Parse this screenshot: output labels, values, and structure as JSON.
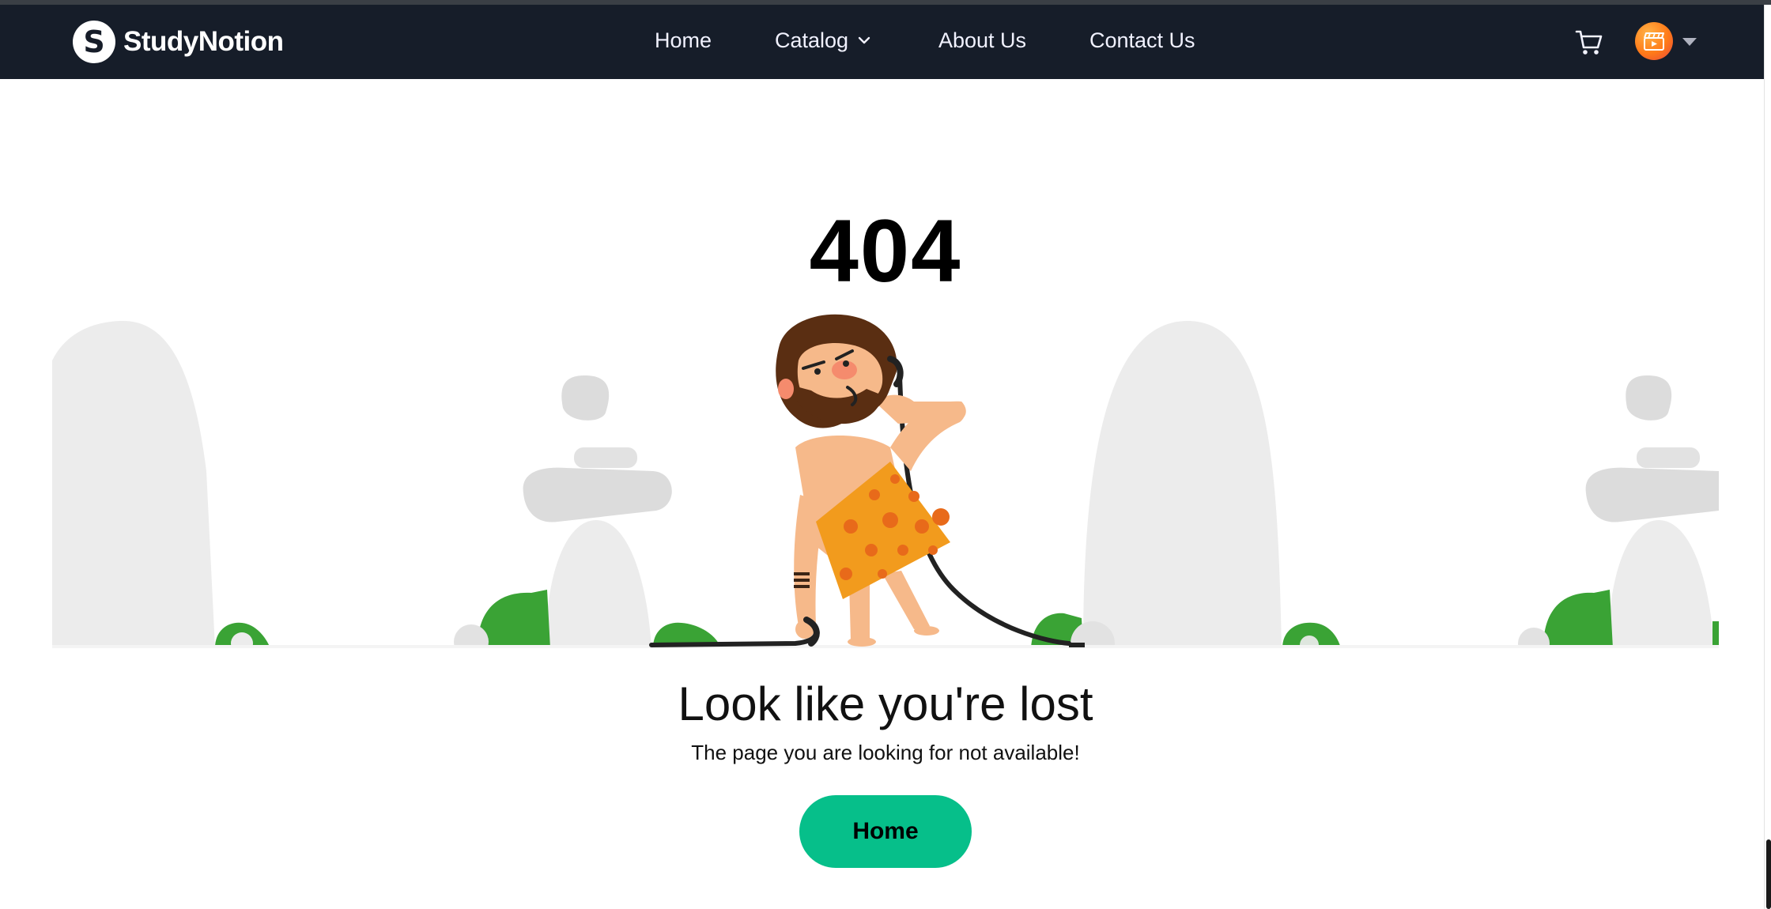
{
  "brand": {
    "logo_letter": "S",
    "name": "StudyNotion"
  },
  "nav": {
    "items": [
      {
        "label": "Home"
      },
      {
        "label": "Catalog",
        "icon": "chevron-down-icon"
      },
      {
        "label": "About Us"
      },
      {
        "label": "Contact Us"
      }
    ]
  },
  "header_icons": {
    "cart": "cart-icon",
    "avatar": "profile-avatar",
    "dropdown": "caret-down-icon"
  },
  "error": {
    "code": "404",
    "headline": "Look like you're lost",
    "message": "The page you are looking for not available!",
    "button_label": "Home"
  },
  "colors": {
    "navbar_bg": "#161d29",
    "nav_text": "#f1f2ff",
    "button_bg": "#06bf8a",
    "illustration_stone": "#ececec",
    "illustration_bush": "#3aa335",
    "caveman_skirt": "#f29b1d"
  }
}
